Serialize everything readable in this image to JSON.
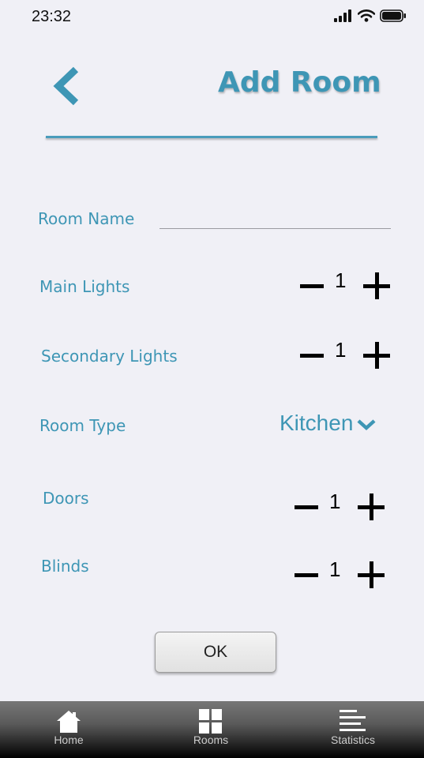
{
  "status_bar": {
    "time": "23:32"
  },
  "header": {
    "title": "Add Room"
  },
  "form": {
    "room_name_label": "Room Name",
    "room_name_value": "",
    "main_lights_label": "Main Lights",
    "main_lights_value": "1",
    "secondary_lights_label": "Secondary Lights",
    "secondary_lights_value": "1",
    "room_type_label": "Room Type",
    "room_type_value": "Kitchen",
    "doors_label": "Doors",
    "doors_value": "1",
    "blinds_label": "Blinds",
    "blinds_value": "1",
    "ok_label": "OK"
  },
  "tabbar": {
    "items": [
      {
        "label": "Home",
        "icon": "home-icon"
      },
      {
        "label": "Rooms",
        "icon": "grid-icon"
      },
      {
        "label": "Statistics",
        "icon": "list-icon"
      }
    ]
  },
  "colors": {
    "accent": "#3e96b5",
    "background": "#f0f0f6"
  }
}
